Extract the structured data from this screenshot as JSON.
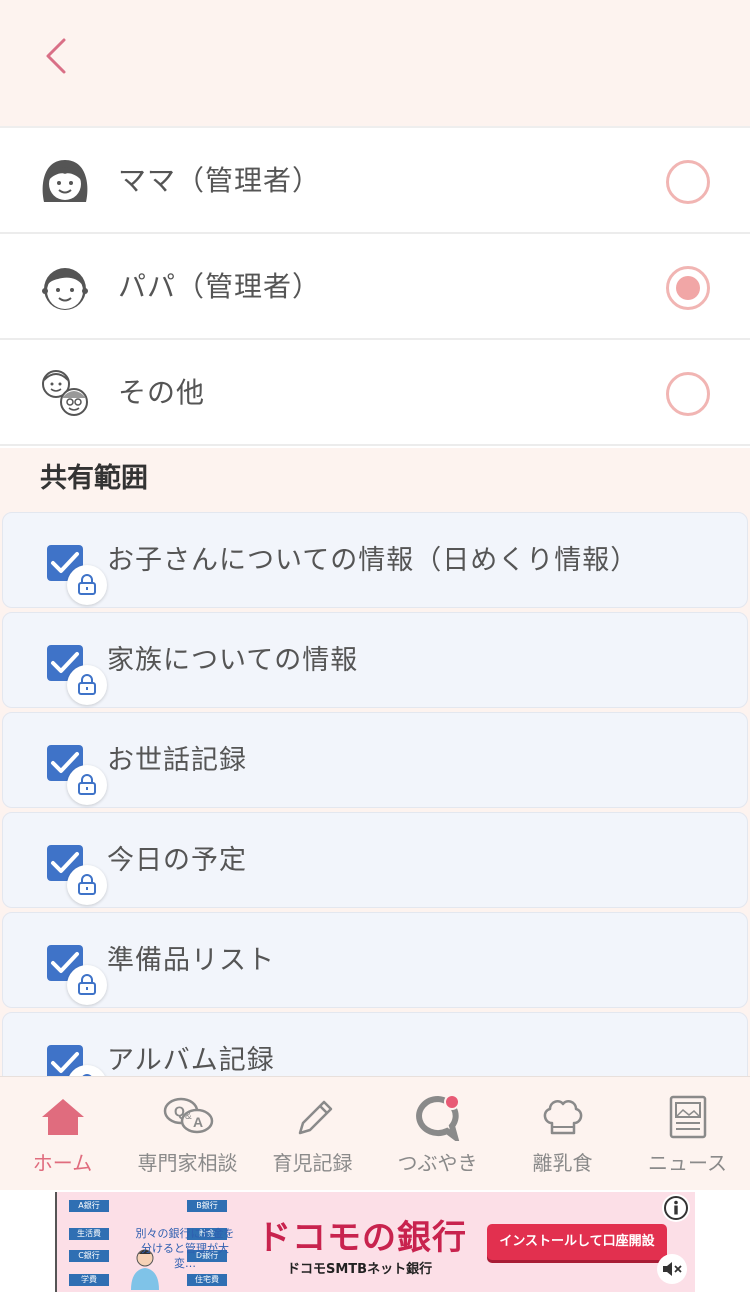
{
  "roles": [
    {
      "label": "ママ（管理者）",
      "selected": false,
      "icon": "mother-avatar-icon"
    },
    {
      "label": "パパ（管理者）",
      "selected": true,
      "icon": "father-avatar-icon"
    },
    {
      "label": "その他",
      "selected": false,
      "icon": "grandparents-avatar-icon"
    }
  ],
  "section_title": "共有範囲",
  "scope_items": [
    {
      "label": "お子さんについての情報（日めくり情報）",
      "checked": true,
      "locked": true
    },
    {
      "label": "家族についての情報",
      "checked": true,
      "locked": true
    },
    {
      "label": "お世話記録",
      "checked": true,
      "locked": true
    },
    {
      "label": "今日の予定",
      "checked": true,
      "locked": true
    },
    {
      "label": "準備品リスト",
      "checked": true,
      "locked": true
    },
    {
      "label": "アルバム記録",
      "checked": true,
      "locked": true
    }
  ],
  "tabs": [
    {
      "label": "ホーム",
      "icon": "home-icon",
      "active": true
    },
    {
      "label": "専門家相談",
      "icon": "qa-icon",
      "active": false
    },
    {
      "label": "育児記録",
      "icon": "pencil-icon",
      "active": false
    },
    {
      "label": "つぶやき",
      "icon": "chat-bubble-icon",
      "active": false
    },
    {
      "label": "離乳食",
      "icon": "chef-hat-icon",
      "active": false
    },
    {
      "label": "ニュース",
      "icon": "newspaper-icon",
      "active": false
    }
  ],
  "ad": {
    "banks": [
      {
        "tag": "A銀行",
        "label": "生活費"
      },
      {
        "tag": "B銀行",
        "label": "貯金"
      },
      {
        "tag": "C銀行",
        "label": "学費"
      },
      {
        "tag": "D銀行",
        "label": "住宅費"
      }
    ],
    "tagline": "別々の銀行にお金を分けると管理が大変…",
    "title": "ドコモの銀行",
    "subtitle": "ドコモSMTBネット銀行",
    "cta": "インストールして口座開設"
  },
  "colors": {
    "accent_pink": "#e06c7e",
    "radio_pink": "#f1b5b3",
    "checkbox_blue": "#3f73c8",
    "header_bg": "#fdf3ef"
  }
}
